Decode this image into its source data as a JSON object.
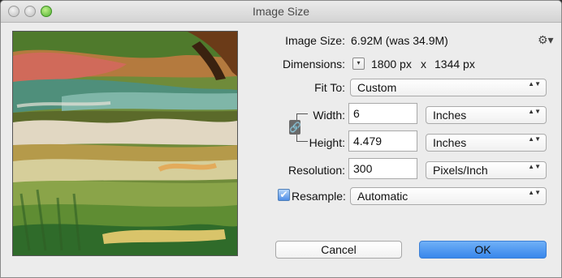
{
  "window": {
    "title": "Image Size"
  },
  "image_size": {
    "label": "Image Size:",
    "value": "6.92M (was 34.9M)"
  },
  "dimensions": {
    "label": "Dimensions:",
    "width": "1800 px",
    "x": "x",
    "height": "1344 px"
  },
  "fit_to": {
    "label": "Fit To:",
    "value": "Custom"
  },
  "width": {
    "label": "Width:",
    "value": "6",
    "unit": "Inches"
  },
  "height": {
    "label": "Height:",
    "value": "4.479",
    "unit": "Inches"
  },
  "resolution": {
    "label": "Resolution:",
    "value": "300",
    "unit": "Pixels/Inch"
  },
  "resample": {
    "label": "Resample:",
    "value": "Automatic",
    "checked": true,
    "check_glyph": "✔"
  },
  "buttons": {
    "cancel": "Cancel",
    "ok": "OK"
  },
  "glyphs": {
    "gear": "⚙▾",
    "link": "🔗",
    "dropdown": "▾",
    "stepper": "▲▼"
  },
  "colors": {
    "ok_button": "#3887eb",
    "window_bg": "#ececec"
  }
}
